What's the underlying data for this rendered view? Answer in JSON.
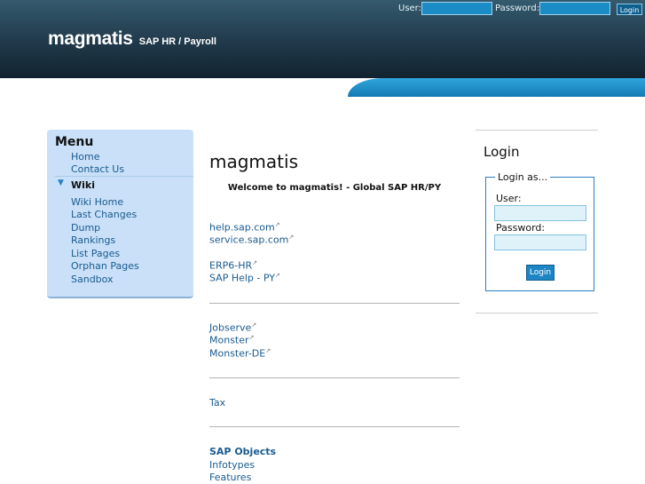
{
  "header": {
    "brand": "magmatis",
    "subtitle": "SAP HR / Payroll"
  },
  "loginbar": {
    "user_label": "User:",
    "user_value": "",
    "password_label": "Password:",
    "password_value": "",
    "login_label": "Login"
  },
  "menu": {
    "title": "Menu",
    "items": [
      "Home",
      "Contact Us"
    ],
    "wiki_label": "Wiki",
    "wiki_items": [
      "Wiki Home",
      "Last Changes",
      "Dump",
      "Rankings",
      "List Pages",
      "Orphan Pages",
      "Sandbox"
    ]
  },
  "main": {
    "title": "magmatis",
    "welcome": "Welcome to magmatis! - Global SAP HR/PY",
    "links_group1": [
      "help.sap.com",
      "service.sap.com"
    ],
    "links_group2": [
      "ERP6-HR",
      "SAP Help - PY"
    ],
    "links_group3": [
      "Jobserve",
      "Monster",
      "Monster-DE"
    ],
    "links_group4": [
      "Tax"
    ],
    "objects_heading": "SAP Objects",
    "objects_links": [
      "Infotypes",
      "Features"
    ]
  },
  "login_panel": {
    "title": "Login",
    "legend": "Login as...",
    "user_label": "User:",
    "user_value": "",
    "password_label": "Password:",
    "password_value": "",
    "button_label": "Login"
  }
}
